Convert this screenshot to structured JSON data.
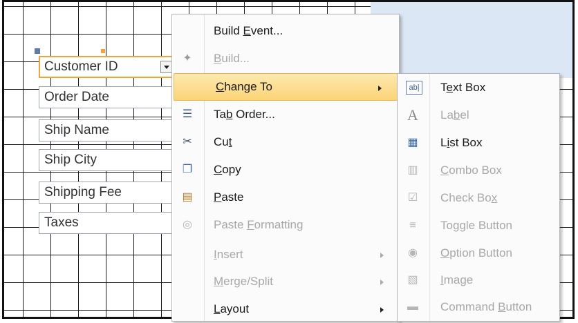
{
  "form_fields": [
    {
      "label": "Customer ID",
      "selected": true
    },
    {
      "label": "Order Date"
    },
    {
      "label": "Ship Name"
    },
    {
      "label": "Ship City"
    },
    {
      "label": "Shipping Fee"
    },
    {
      "label": "Taxes"
    }
  ],
  "context_menu": {
    "items": [
      {
        "pre": "Build ",
        "key": "E",
        "post": "vent...",
        "enabled": true
      },
      {
        "pre": "",
        "key": "B",
        "post": "uild...",
        "enabled": false,
        "icon": "build-icon"
      },
      {
        "pre": "",
        "key": "C",
        "post": "hange To",
        "enabled": true,
        "highlighted": true,
        "submenu": true
      },
      {
        "pre": "Ta",
        "key": "b",
        "post": " Order...",
        "enabled": true,
        "icon": "tab-order-icon"
      },
      {
        "pre": "Cu",
        "key": "t",
        "post": "",
        "enabled": true,
        "icon": "scissors-icon"
      },
      {
        "pre": "",
        "key": "C",
        "post": "opy",
        "enabled": true,
        "icon": "copy-icon"
      },
      {
        "pre": "",
        "key": "P",
        "post": "aste",
        "enabled": true,
        "icon": "paste-icon"
      },
      {
        "pre": "Paste ",
        "key": "F",
        "post": "ormatting",
        "enabled": false,
        "icon": "paste-formatting-icon"
      },
      {
        "pre": "",
        "key": "I",
        "post": "nsert",
        "enabled": false,
        "submenu": true
      },
      {
        "pre": "",
        "key": "M",
        "post": "erge/Split",
        "enabled": false,
        "submenu": true
      },
      {
        "pre": "",
        "key": "L",
        "post": "ayout",
        "enabled": true,
        "submenu": true
      }
    ]
  },
  "change_to_submenu": {
    "items": [
      {
        "pre": "T",
        "key": "e",
        "post": "xt Box",
        "enabled": true,
        "icon": "text-box-icon"
      },
      {
        "pre": "La",
        "key": "b",
        "post": "el",
        "enabled": false,
        "icon": "label-icon"
      },
      {
        "pre": "L",
        "key": "i",
        "post": "st Box",
        "enabled": true,
        "icon": "list-box-icon"
      },
      {
        "pre": "",
        "key": "C",
        "post": "ombo Box",
        "enabled": false,
        "icon": "combo-box-icon"
      },
      {
        "pre": "Check Bo",
        "key": "x",
        "post": "",
        "enabled": false,
        "icon": "check-box-icon"
      },
      {
        "pre": "To",
        "key": "g",
        "post": "gle Button",
        "enabled": false,
        "icon": "toggle-button-icon"
      },
      {
        "pre": "",
        "key": "O",
        "post": "ption Button",
        "enabled": false,
        "icon": "option-button-icon"
      },
      {
        "pre": "",
        "key": "I",
        "post": "mage",
        "enabled": false,
        "icon": "image-icon"
      },
      {
        "pre": "Command ",
        "key": "B",
        "post": "utton",
        "enabled": false,
        "icon": "command-button-icon"
      }
    ]
  },
  "colors": {
    "highlight": "#fbd476",
    "selection_border": "#f0a33a",
    "disabled_text": "#a8a8a8"
  }
}
